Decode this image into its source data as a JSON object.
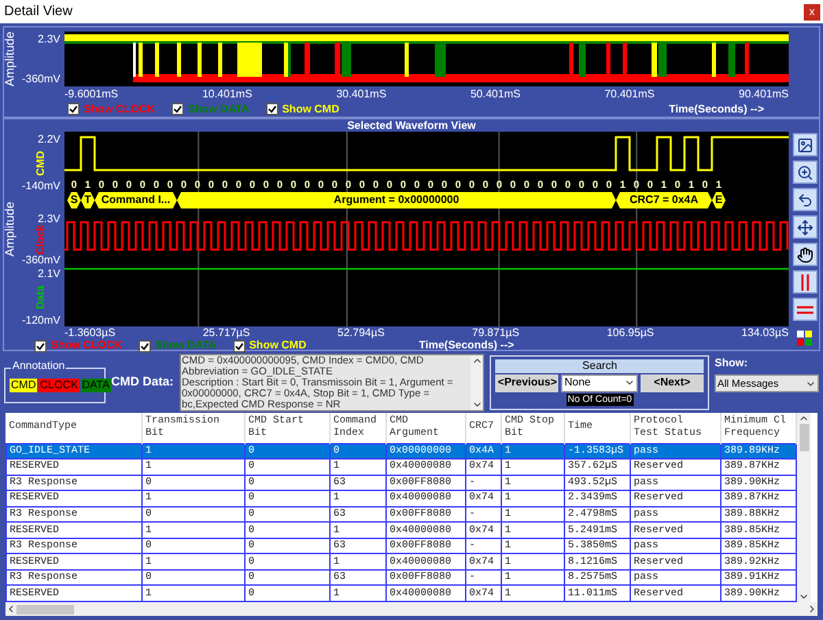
{
  "window": {
    "title": "Detail View",
    "close": "x"
  },
  "overview": {
    "y_axis_label": "Amplitude",
    "y_max": "2.3V",
    "y_min": "-360mV",
    "x_ticks": [
      "-9.6001mS",
      "10.401mS",
      "30.401mS",
      "50.401mS",
      "70.401mS",
      "90.401mS"
    ],
    "x_axis_label": "Time(Seconds) -->",
    "toggles": [
      {
        "label": "Show CLOCK",
        "checked": true,
        "color": "#ff0000"
      },
      {
        "label": "Show DATA",
        "checked": true,
        "color": "#008000"
      },
      {
        "label": "Show CMD",
        "checked": true,
        "color": "#ffff00"
      }
    ]
  },
  "selected_view": {
    "title": "Selected Waveform View",
    "y_axis_label": "Amplitude",
    "lanes": [
      {
        "name": "CMD",
        "max": "2.2V",
        "min": "-140mV",
        "color": "#ffff00"
      },
      {
        "name": "Clock",
        "max": "2.3V",
        "min": "-360mV",
        "color": "#ff0000"
      },
      {
        "name": "Data",
        "max": "2.1V",
        "min": "-120mV",
        "color": "#00c000"
      }
    ],
    "bits": [
      "0",
      "1",
      "0",
      "0",
      "0",
      "0",
      "0",
      "0",
      "0",
      "0",
      "0",
      "0",
      "0",
      "0",
      "0",
      "0",
      "0",
      "0",
      "0",
      "0",
      "0",
      "0",
      "0",
      "0",
      "0",
      "0",
      "0",
      "0",
      "0",
      "0",
      "0",
      "0",
      "0",
      "0",
      "0",
      "0",
      "0",
      "0",
      "0",
      "0",
      "1",
      "0",
      "0",
      "1",
      "0",
      "1",
      "0",
      "1"
    ],
    "segments": [
      {
        "label": "S"
      },
      {
        "label": "T"
      },
      {
        "label": "Command I..."
      },
      {
        "label": "Argument = 0x00000000"
      },
      {
        "label": "CRC7 = 0x4A"
      },
      {
        "label": "E"
      }
    ],
    "x_ticks": [
      "-1.3603µS",
      "25.717µS",
      "52.794µS",
      "79.871µS",
      "106.95µS",
      "134.03µS"
    ],
    "x_axis_label": "Time(Seconds) -->",
    "toggles": [
      {
        "label": "Show CLOCK",
        "checked": true,
        "color": "#ff0000"
      },
      {
        "label": "Show DATA",
        "checked": true,
        "color": "#008000"
      },
      {
        "label": "Show CMD",
        "checked": true,
        "color": "#ffff00"
      }
    ]
  },
  "annotation": {
    "title": "Annotation",
    "items": [
      {
        "label": "CMD",
        "color": "#ffff00"
      },
      {
        "label": "CLOCK",
        "color": "#ff0000"
      },
      {
        "label": "DATA",
        "color": "#008000"
      }
    ]
  },
  "cmd_data": {
    "label": "CMD Data:",
    "text": "CMD = 0x400000000095, CMD Index = CMD0, CMD Abbreviation = GO_IDLE_STATE\nDescription : Start Bit = 0, Transmissoin Bit = 1, Argument = 0x00000000, CRC7 = 0x4A,  Stop Bit = 1, CMD Type = bc,Expected CMD Response = NR"
  },
  "search": {
    "title": "Search",
    "previous": "<Previous>",
    "filter": "None",
    "next": "<Next>",
    "count": "No Of Count=0"
  },
  "show": {
    "label": "Show:",
    "value": "All Messages"
  },
  "table": {
    "columns": [
      "CommandType",
      "Transmission\nBit",
      "CMD Start\nBit",
      "Command\nIndex",
      "CMD\nArgument",
      "CRC7",
      "CMD Stop\nBit",
      "Time",
      "Protocol\nTest Status",
      "Minimum Cl\nFrequency"
    ],
    "rows": [
      {
        "selected": true,
        "cells": [
          "GO_IDLE_STATE",
          "1",
          "0",
          "0",
          "0x00000000",
          "0x4A",
          "1",
          "-1.3583µS",
          "pass",
          "389.89KHz"
        ]
      },
      {
        "selected": false,
        "cells": [
          "RESERVED",
          "1",
          "0",
          "1",
          "0x40000080",
          "0x74",
          "1",
          "357.62µS",
          "Reserved",
          "389.87KHz"
        ]
      },
      {
        "selected": false,
        "cells": [
          "R3 Response",
          "0",
          "0",
          "63",
          "0x00FF8080",
          "-",
          "1",
          "493.52µS",
          "pass",
          "389.90KHz"
        ]
      },
      {
        "selected": false,
        "cells": [
          "RESERVED",
          "1",
          "0",
          "1",
          "0x40000080",
          "0x74",
          "1",
          "2.3439mS",
          "Reserved",
          "389.87KHz"
        ]
      },
      {
        "selected": false,
        "cells": [
          "R3 Response",
          "0",
          "0",
          "63",
          "0x00FF8080",
          "-",
          "1",
          "2.4798mS",
          "pass",
          "389.88KHz"
        ]
      },
      {
        "selected": false,
        "cells": [
          "RESERVED",
          "1",
          "0",
          "1",
          "0x40000080",
          "0x74",
          "1",
          "5.2491mS",
          "Reserved",
          "389.85KHz"
        ]
      },
      {
        "selected": false,
        "cells": [
          "R3 Response",
          "0",
          "0",
          "63",
          "0x00FF8080",
          "-",
          "1",
          "5.3850mS",
          "pass",
          "389.85KHz"
        ]
      },
      {
        "selected": false,
        "cells": [
          "RESERVED",
          "1",
          "0",
          "1",
          "0x40000080",
          "0x74",
          "1",
          "8.1216mS",
          "Reserved",
          "389.92KHz"
        ]
      },
      {
        "selected": false,
        "cells": [
          "R3 Response",
          "0",
          "0",
          "63",
          "0x00FF8080",
          "-",
          "1",
          "8.2575mS",
          "pass",
          "389.91KHz"
        ]
      },
      {
        "selected": false,
        "cells": [
          "RESERVED",
          "1",
          "0",
          "1",
          "0x40000080",
          "0x74",
          "1",
          "11.011mS",
          "Reserved",
          "389.90KHz"
        ]
      }
    ]
  }
}
